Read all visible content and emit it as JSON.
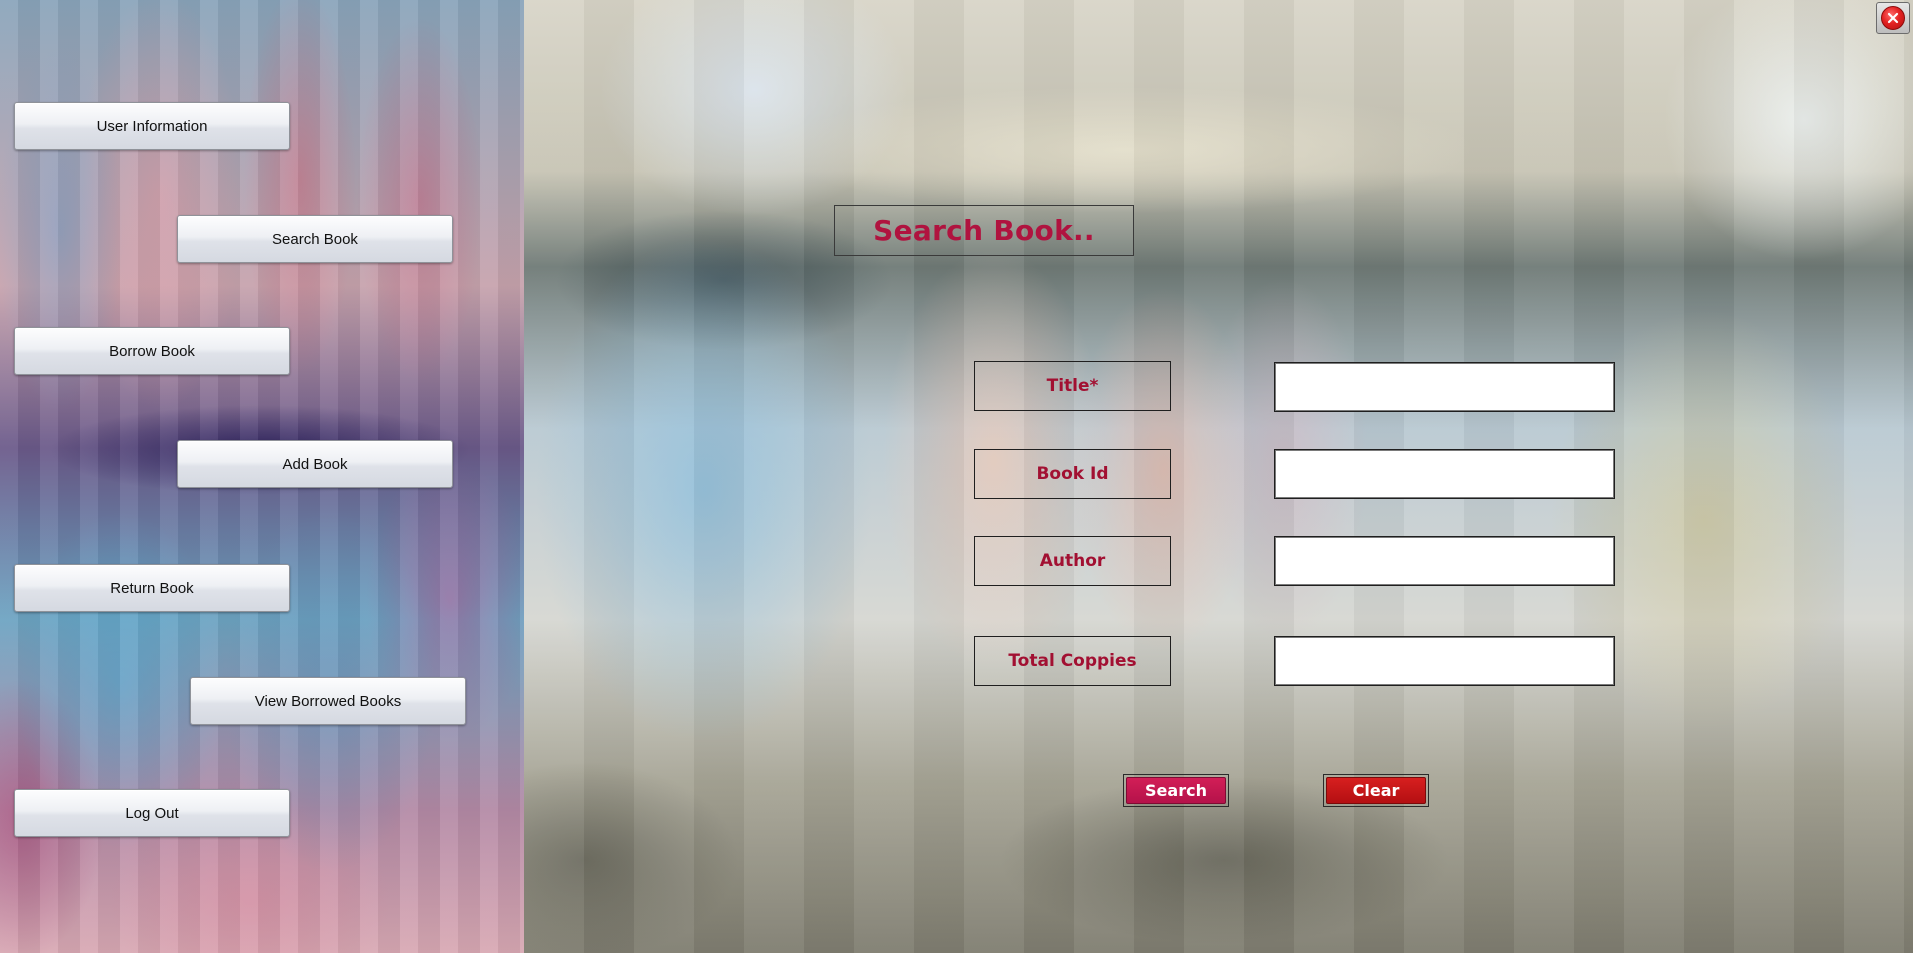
{
  "sidebar": {
    "buttons": [
      {
        "label": "User Information"
      },
      {
        "label": "Search Book"
      },
      {
        "label": "Borrow Book"
      },
      {
        "label": "Add Book"
      },
      {
        "label": "Return Book"
      },
      {
        "label": "View Borrowed Books"
      },
      {
        "label": "Log Out"
      }
    ]
  },
  "form": {
    "title": "Search Book..",
    "fields": [
      {
        "label": "Title*",
        "value": ""
      },
      {
        "label": "Book Id",
        "value": ""
      },
      {
        "label": "Author",
        "value": ""
      },
      {
        "label": "Total Coppies",
        "value": ""
      }
    ],
    "search_label": "Search",
    "clear_label": "Clear"
  },
  "window": {
    "close_icon": "close-icon",
    "close_color": "#e32222"
  }
}
